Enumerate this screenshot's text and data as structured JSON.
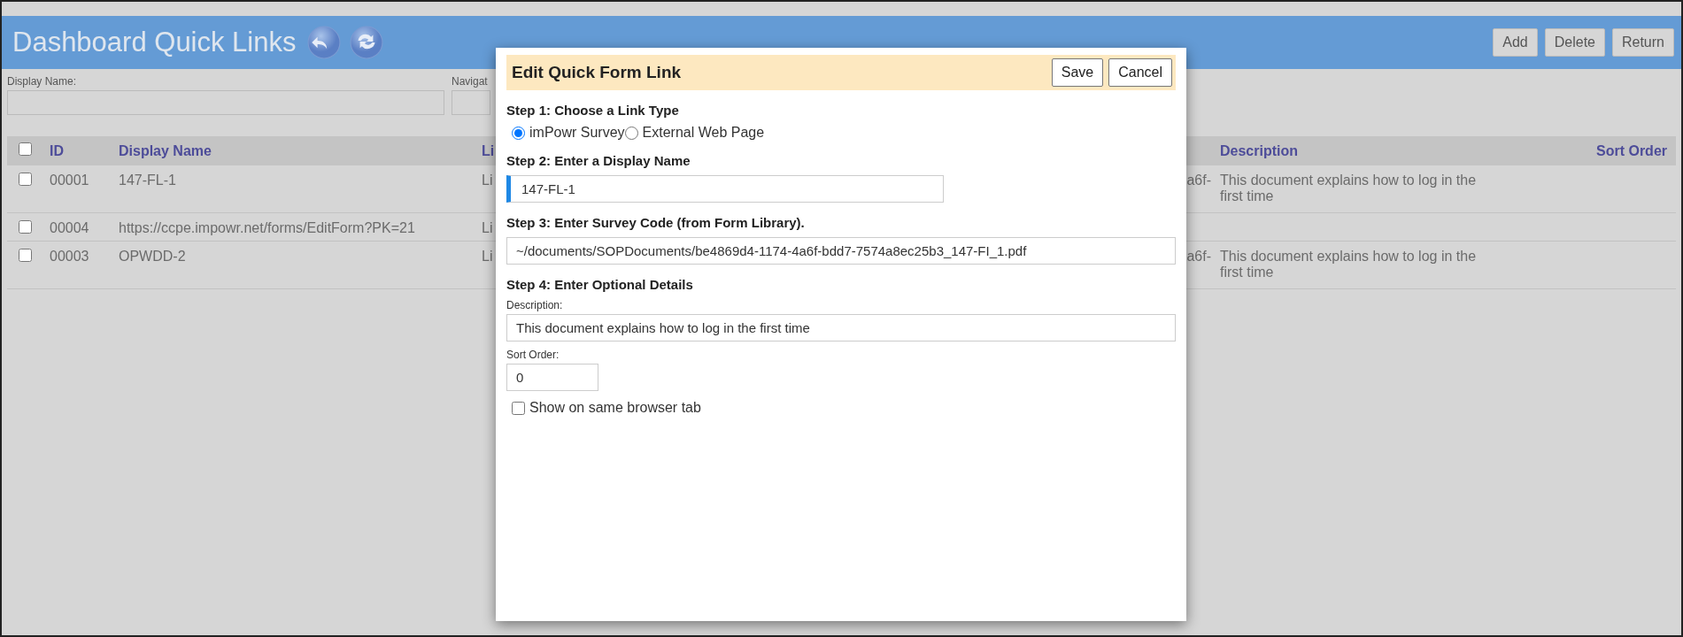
{
  "page": {
    "title": "Dashboard Quick Links",
    "buttons": [
      "Add",
      "Delete",
      "Return"
    ]
  },
  "filters": [
    {
      "label": "Display Name:"
    },
    {
      "label": "Navigat"
    }
  ],
  "table": {
    "select_all_checked": false,
    "columns": [
      "ID",
      "Display Name",
      "Li",
      "Description",
      "Sort Order"
    ],
    "rows": [
      {
        "checked": false,
        "id": "00001",
        "display_name": "147-FL-1",
        "column_3": "Li",
        "column_4": "a6f-",
        "description": "This document explains how to log in the first time"
      },
      {
        "checked": false,
        "id": "00004",
        "display_name": "https://ccpe.impowr.net/forms/EditForm?PK=21",
        "column_3": "Li"
      },
      {
        "checked": false,
        "id": "00003",
        "display_name": "OPWDD-2",
        "column_3": "Li",
        "column_4": "a6f-",
        "description": "This document explains how to log in the first time"
      }
    ]
  },
  "dialog": {
    "title": "Edit Quick Form Link",
    "buttons": [
      "Save",
      "Cancel"
    ],
    "step_1": {
      "heading": "Step 1: Choose a Link Type",
      "options": [
        {
          "label": "imPowr Survey",
          "selected": true
        },
        {
          "label": "External Web Page",
          "selected": false
        }
      ]
    },
    "step_2": {
      "heading": "Step 2: Enter a Display Name",
      "value": "147-FL-1",
      "focused": true
    },
    "step_3": {
      "heading": "Step 3: Enter Survey Code (from Form Library).",
      "value": "~/documents/SOPDocuments/be4869d4-1174-4a6f-bdd7-7574a8ec25b3_147-FI_1.pdf"
    },
    "step_4": {
      "heading": "Step 4: Enter Optional Details",
      "description_label": "Description:",
      "description": "This document explains how to log in the first time",
      "sort_order_label": "Sort Order:",
      "sort_order": "0",
      "same_tab": {
        "label": "Show on same browser tab",
        "checked": false
      }
    }
  }
}
